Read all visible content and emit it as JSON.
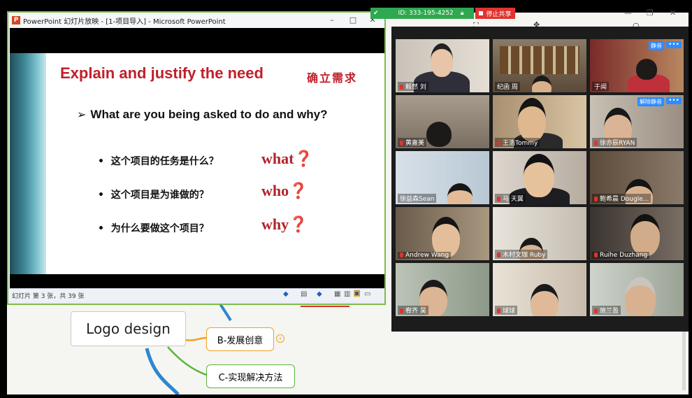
{
  "ppt": {
    "window_title": "PowerPoint 幻灯片放映 - [1-项目导入] - Microsoft PowerPoint",
    "status": "幻灯片 第 3 张，共 39 张"
  },
  "slide": {
    "title": "Explain and justify the need",
    "title_cn": "确立需求",
    "question": "What are you being asked to do and why?",
    "bullets": [
      {
        "text": "这个项目的任务是什么？",
        "tag": "what"
      },
      {
        "text": "这个项目是为谁做的？",
        "tag": "who"
      },
      {
        "text": "为什么要做这个项目？",
        "tag": "why"
      }
    ]
  },
  "mindmap": {
    "root": "Logo design",
    "node_b": "B-发展创意",
    "node_c": "C-实现解决方法"
  },
  "zoom": {
    "meeting_id": "ID: 333-195-4252",
    "stop_share": "停止共享",
    "mute_tag": "静音",
    "unmute_tag": "解除静音",
    "participants": [
      "毅然 刘",
      "纪函 周",
      "于闻",
      "黄嘉美",
      "王浩Tommy",
      "徐亦辰RYAN",
      "徐益森Sean",
      "马 天翼",
      "鲍希晨 Dougle...",
      "Andrew Wang",
      "木村文珈 Ruby",
      "Ruihe Duzhang",
      "宥齐 吴",
      "球球",
      "施兰盈"
    ]
  },
  "colors": {
    "title_red": "#c0202a",
    "zoom_green": "#2fa84f",
    "zoom_red": "#e0332f",
    "zoom_blue": "#2d8cff"
  }
}
